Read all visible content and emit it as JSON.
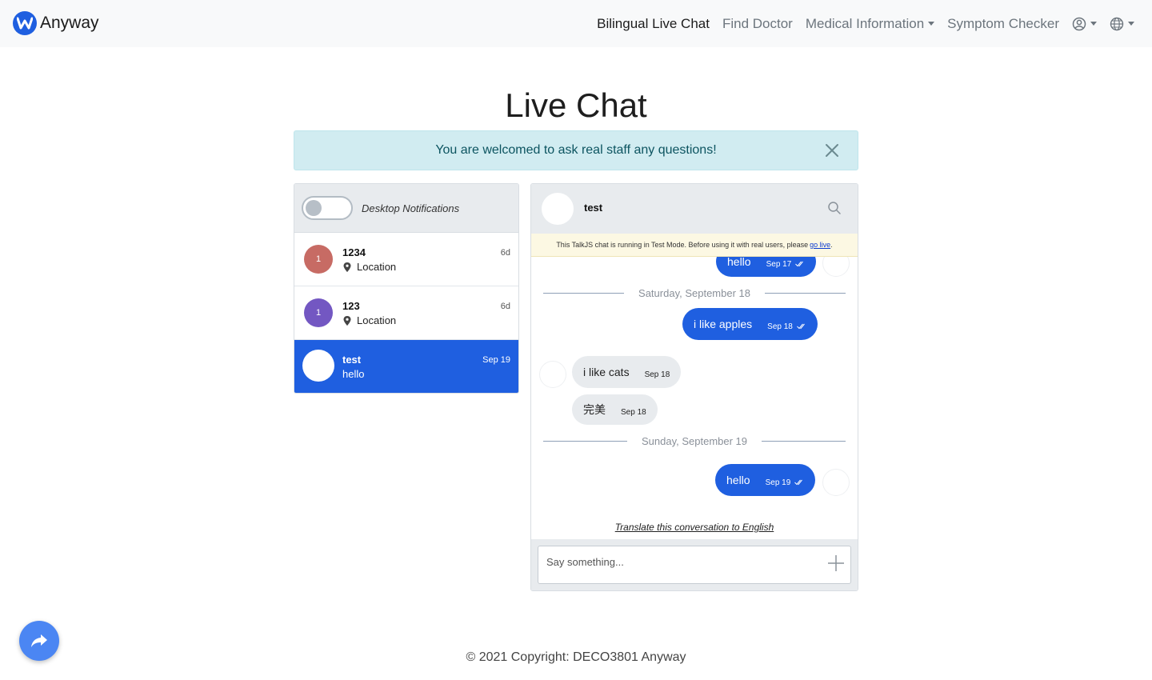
{
  "navbar": {
    "brand_text": "Anyway",
    "brand_logo_letter": "W",
    "links": {
      "live_chat": "Bilingual Live Chat",
      "find_doctor": "Find Doctor",
      "medical_info": "Medical Information",
      "symptom_checker": "Symptom Checker"
    }
  },
  "page": {
    "title": "Live Chat"
  },
  "alert": {
    "text": "You are welcomed to ask real staff any questions!"
  },
  "inbox": {
    "notifications_label": "Desktop Notifications",
    "conversations": [
      {
        "name": "1234",
        "subtitle": "Location",
        "time": "6d",
        "avatar_text": "1",
        "avatar_color": "#c76b64"
      },
      {
        "name": "123",
        "subtitle": "Location",
        "time": "6d",
        "avatar_text": "1",
        "avatar_color": "#7357c2"
      },
      {
        "name": "test",
        "subtitle": "hello",
        "time": "Sep 19",
        "avatar_text": "",
        "avatar_color": "#ffffff"
      }
    ]
  },
  "chat": {
    "header_name": "test",
    "test_mode_text": "This TalkJS chat is running in Test Mode. Before using it with real users, please",
    "test_mode_link": "go live",
    "test_mode_end": ".",
    "messages": {
      "m1": {
        "text": "hello",
        "time": "Sep 17"
      },
      "divider1": "Saturday, September 18",
      "m2": {
        "text": "i like apples",
        "time": "Sep 18"
      },
      "m3": {
        "text": "i like cats",
        "time": "Sep 18"
      },
      "m4": {
        "text": "完美",
        "time": "Sep 18"
      },
      "divider2": "Sunday, September 19",
      "m5": {
        "text": "hello",
        "time": "Sep 19"
      }
    },
    "translate_link": "Translate this conversation to English",
    "composer_placeholder": "Say something..."
  },
  "footer": {
    "text": "© 2021 Copyright: DECO3801 Anyway"
  },
  "colors": {
    "accent": "#1f5fe0",
    "alert_bg": "#d1ecf1",
    "alert_text": "#0c5460",
    "navbar_bg": "#f8f9fa",
    "fab": "#4b86f3"
  },
  "icons": {
    "brand": "w-logo-icon",
    "user": "user-circle-icon",
    "language": "globe-icon",
    "close": "close-icon",
    "search": "search-icon",
    "location": "map-pin-icon",
    "read": "double-check-icon",
    "attach": "plus-icon",
    "share": "share-arrow-icon"
  }
}
